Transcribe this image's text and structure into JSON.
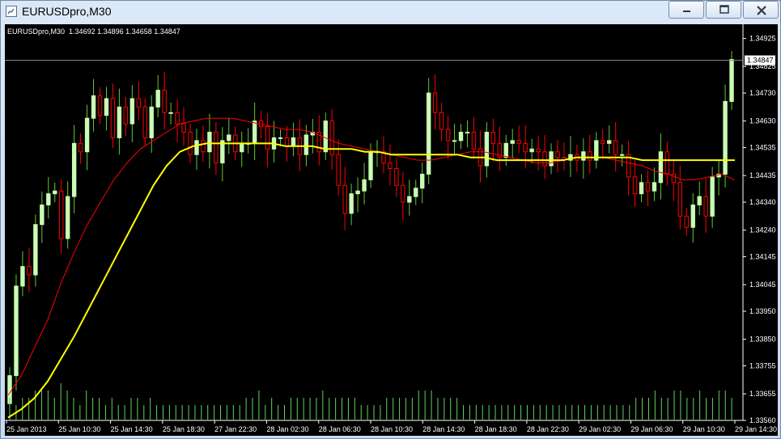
{
  "window": {
    "title": "EURUSDpro,M30",
    "buttons": {
      "minimize": "minimize",
      "maximize": "maximize",
      "close": "close"
    }
  },
  "chart_info": {
    "symbol": "EURUSDpro,M30",
    "open": "1.34692",
    "high": "1.34896",
    "low": "1.34658",
    "close": "1.34847",
    "current_price_label": "1.34847"
  },
  "colors": {
    "background": "#000000",
    "bull_body": "#c8ffb4",
    "bear_body": "#000000",
    "bear_outline": "#ff0000",
    "bull_wick": "#64c832",
    "ma_fast": "#ff0000",
    "ma_slow": "#ffff00",
    "volume": "#5fd35f",
    "axis": "#ffffff"
  },
  "chart_data": {
    "type": "candlestick",
    "symbol": "EURUSDpro",
    "timeframe": "M30",
    "y_ticks": [
      "1.34925",
      "1.34825",
      "1.34730",
      "1.34630",
      "1.34535",
      "1.34435",
      "1.34340",
      "1.34240",
      "1.34145",
      "1.34045",
      "1.33950",
      "1.33850",
      "1.33755",
      "1.33655",
      "1.33560"
    ],
    "ylim": [
      1.3356,
      1.3497
    ],
    "x_tick_labels": [
      "25 Jan 2013",
      "25 Jan 10:30",
      "25 Jan 14:30",
      "25 Jan 18:30",
      "27 Jan 22:30",
      "28 Jan 02:30",
      "28 Jan 06:30",
      "28 Jan 10:30",
      "28 Jan 14:30",
      "28 Jan 18:30",
      "28 Jan 22:30",
      "29 Jan 02:30",
      "29 Jan 06:30",
      "29 Jan 10:30",
      "29 Jan 14:30"
    ],
    "close_series": [
      1.3372,
      1.3404,
      1.3411,
      1.3408,
      1.3426,
      1.3433,
      1.3437,
      1.3438,
      1.3421,
      1.3436,
      1.3455,
      1.3452,
      1.3464,
      1.3472,
      1.3465,
      1.3471,
      1.3457,
      1.3468,
      1.3462,
      1.3471,
      1.3468,
      1.3457,
      1.3468,
      1.3474,
      1.3466,
      1.3466,
      1.3462,
      1.3459,
      1.3451,
      1.3456,
      1.3452,
      1.3459,
      1.3448,
      1.3456,
      1.3458,
      1.3452,
      1.3455,
      1.3455,
      1.3463,
      1.3461,
      1.3453,
      1.3457,
      1.3457,
      1.3454,
      1.3457,
      1.3451,
      1.3458,
      1.3459,
      1.3452,
      1.3463,
      1.3451,
      1.344,
      1.343,
      1.3437,
      1.3438,
      1.3442,
      1.3452,
      1.3452,
      1.3448,
      1.3446,
      1.344,
      1.3434,
      1.3436,
      1.3439,
      1.3444,
      1.3473,
      1.3466,
      1.346,
      1.3456,
      1.3456,
      1.3459,
      1.3459,
      1.3453,
      1.3447,
      1.3459,
      1.3455,
      1.345,
      1.3455,
      1.3456,
      1.3455,
      1.3452,
      1.3453,
      1.3452,
      1.3447,
      1.3452,
      1.345,
      1.3449,
      1.3451,
      1.3449,
      1.3452,
      1.3449,
      1.3456,
      1.3455,
      1.3456,
      1.3451,
      1.3451,
      1.3443,
      1.3437,
      1.3441,
      1.3438,
      1.3441,
      1.3452,
      1.3444,
      1.3441,
      1.3429,
      1.3425,
      1.3433,
      1.3436,
      1.3429,
      1.3443,
      1.3444,
      1.347,
      1.3485
    ],
    "ma_fast_series": [
      1.3365,
      1.3372,
      1.3382,
      1.3392,
      1.3405,
      1.3416,
      1.3426,
      1.3434,
      1.3442,
      1.3448,
      1.3453,
      1.3456,
      1.3459,
      1.3462,
      1.3463,
      1.3464,
      1.3464,
      1.3464,
      1.3463,
      1.3462,
      1.3461,
      1.346,
      1.346,
      1.3459,
      1.3457,
      1.3455,
      1.3454,
      1.3453,
      1.3452,
      1.3451,
      1.345,
      1.3449,
      1.3449,
      1.345,
      1.3451,
      1.3452,
      1.3452,
      1.3451,
      1.345,
      1.3449,
      1.3448,
      1.3448,
      1.3449,
      1.345,
      1.345,
      1.345,
      1.3449,
      1.3448,
      1.3447,
      1.3445,
      1.3444,
      1.3442,
      1.3442,
      1.3443,
      1.3444,
      1.3442
    ],
    "ma_slow_series": [
      1.3357,
      1.336,
      1.3364,
      1.337,
      1.3378,
      1.3386,
      1.3395,
      1.3404,
      1.3413,
      1.3422,
      1.3431,
      1.344,
      1.3447,
      1.3452,
      1.3454,
      1.3455,
      1.3455,
      1.3455,
      1.3455,
      1.3455,
      1.3455,
      1.3454,
      1.3454,
      1.3454,
      1.3453,
      1.3453,
      1.3453,
      1.3452,
      1.3452,
      1.3451,
      1.3451,
      1.3451,
      1.3451,
      1.3451,
      1.3451,
      1.345,
      1.345,
      1.3449,
      1.3449,
      1.3449,
      1.3449,
      1.3449,
      1.3449,
      1.345,
      1.345,
      1.345,
      1.345,
      1.345,
      1.3449,
      1.3449,
      1.3449,
      1.3449,
      1.3449,
      1.3449,
      1.3449,
      1.3449
    ],
    "volume_series": [
      3,
      2,
      3,
      3,
      4,
      4,
      4,
      3,
      5,
      4,
      3,
      2,
      4,
      3,
      3,
      2,
      3,
      2,
      2,
      3,
      3,
      2,
      3,
      2,
      2,
      2,
      2,
      2,
      2,
      2,
      2,
      2,
      2,
      2,
      2,
      2,
      2,
      3,
      3,
      4,
      2,
      3,
      2,
      2,
      3,
      3,
      3,
      3,
      3,
      4,
      3,
      3,
      3,
      3,
      3,
      2,
      2,
      2,
      2,
      3,
      3,
      3,
      3,
      3,
      4,
      4,
      4,
      3,
      3,
      3,
      3,
      2,
      2,
      2,
      2,
      2,
      2,
      2,
      2,
      2,
      2,
      2,
      2,
      2,
      2,
      2,
      2,
      2,
      2,
      2,
      2,
      2,
      2,
      2,
      2,
      2,
      2,
      2,
      3,
      3,
      3,
      4,
      3,
      3,
      4,
      4,
      3,
      3,
      4,
      3,
      3,
      4,
      4,
      3
    ]
  }
}
